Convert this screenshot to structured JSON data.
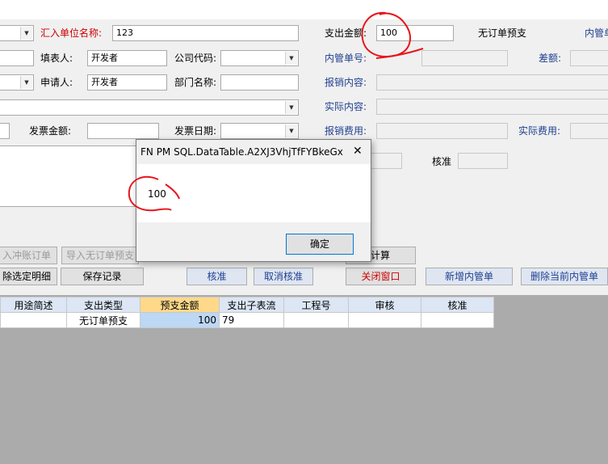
{
  "form": {
    "remit_unit_label": "汇入单位名称:",
    "remit_unit_value": "123",
    "expense_amount_label": "支出金额:",
    "expense_amount_value": "100",
    "expense_type_text": "无订单预支",
    "internal_order_label_top": "内管单",
    "filler_label": "填表人:",
    "filler_value": "开发者",
    "company_code_label": "公司代码:",
    "internal_order_no_label": "内管单号:",
    "difference_label": "差额:",
    "applicant_label": "申请人:",
    "applicant_value": "开发者",
    "dept_name_label": "部门名称:",
    "reimburse_content_label": "报销内容:",
    "actual_content_label": "实际内容:",
    "invoice_amount_label": "发票金额:",
    "invoice_date_label": "发票日期:",
    "reimburse_cost_label": "报销费用:",
    "actual_cost_label": "实际费用:",
    "approve_label": "核准"
  },
  "buttons": {
    "offset_order": "入冲账订单",
    "import_no_order": "导入无订单预支",
    "calculate": "计算",
    "delete_selected": "除选定明细",
    "save_record": "保存记录",
    "approve": "核准",
    "cancel_approve": "取消核准",
    "close_window": "关闭窗口",
    "add_internal_order": "新增内管单",
    "delete_internal_order": "删除当前内管单"
  },
  "grid": {
    "columns": [
      "用途简述",
      "支出类型",
      "预支金额",
      "支出子表流",
      "工程号",
      "审核",
      "核准"
    ],
    "rows": [
      [
        "",
        "无订单预支",
        "100",
        "79",
        "",
        "",
        ""
      ]
    ]
  },
  "dialog": {
    "title": "FN PM SQL.DataTable.A2XJ3VhjTfFYBkeGx",
    "message": "100",
    "ok_label": "确定",
    "close_symbol": "✕"
  }
}
